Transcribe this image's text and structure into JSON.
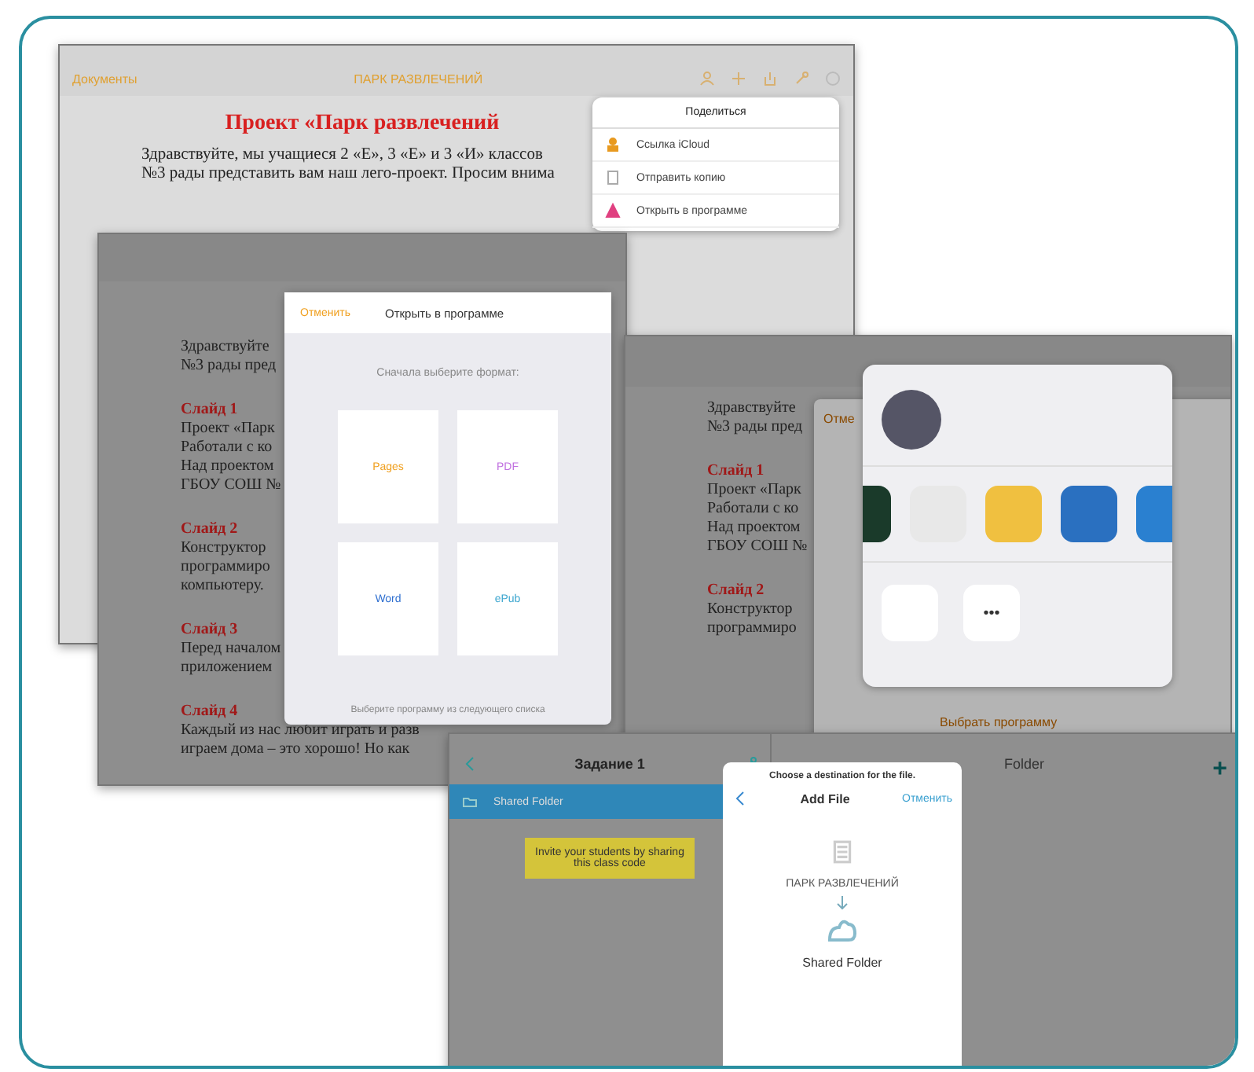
{
  "document_window": {
    "nav_left": "Документы",
    "nav_title": "ПАРК РАЗВЛЕЧЕНИЙ",
    "heading": "Проект «Парк развлечений",
    "body": [
      "Здравствуйте, мы учащиеся 2 «Е», 3 «Е» и 3 «И» классов",
      "№3 рады представить вам наш лего-проект. Просим внима"
    ]
  },
  "share_menu": {
    "title": "Поделиться",
    "items": [
      {
        "kind": "person",
        "label": "Ссылка iCloud"
      },
      {
        "kind": "document",
        "label": "Отправить копию"
      },
      {
        "kind": "app",
        "label": "Открыть в программе"
      }
    ]
  },
  "format_window": {
    "paragraphs": [
      {
        "lines": [
          "Здравствуйте",
          "№3 рады пред"
        ]
      },
      {
        "title": "Слайд 1",
        "lines": [
          "Проект «Парк",
          "Работали с ко",
          "Над проектом",
          "ГБОУ СОШ №"
        ]
      },
      {
        "title": "Слайд 2",
        "lines": [
          "Конструктор",
          "программиро",
          "компьютеру."
        ]
      },
      {
        "title": "Слайд 3",
        "lines": [
          "Перед началом",
          "приложением"
        ]
      },
      {
        "title": "Слайд 4",
        "lines": [
          "Каждый из нас любит играть и разв",
          "играем дома – это хорошо! Но как"
        ]
      }
    ]
  },
  "format_dialog": {
    "cancel": "Отменить",
    "title": "Открыть в программе",
    "prompt": "Сначала выберите формат:",
    "formats": [
      {
        "label": "Pages",
        "color": "#f0a020"
      },
      {
        "label": "PDF",
        "color": "#c070e0"
      },
      {
        "label": "Word",
        "color": "#3070d0"
      },
      {
        "label": "ePub",
        "color": "#40a8d0"
      }
    ],
    "footer": "Выберите программу из следующего списка"
  },
  "share_window": {
    "paragraphs": [
      {
        "lines": [
          "Здравствуйте",
          "№3 рады пред"
        ]
      },
      {
        "title": "Слайд 1",
        "lines": [
          "Проект «Парк",
          "Работали с ко",
          "Над проектом",
          "ГБОУ СОШ №"
        ]
      },
      {
        "title": "Слайд 2",
        "lines": [
          "Конструктор",
          "программиро"
        ]
      }
    ],
    "cancel": "Отме",
    "more": "•••",
    "pick_app": "Выбрать программу"
  },
  "add_file_window": {
    "title": "Задание 1",
    "folder": {
      "label": "Shared Folder",
      "selected": true
    },
    "note": "Invite your students by sharing this class code",
    "right_title": "Folder",
    "add": "+",
    "dialog": {
      "caption": "Choose a destination for the file.",
      "title": "Add File",
      "cancel": "Отменить",
      "file_name": "ПАРК РАЗВЛЕЧЕНИЙ",
      "destination": "Shared Folder"
    }
  }
}
